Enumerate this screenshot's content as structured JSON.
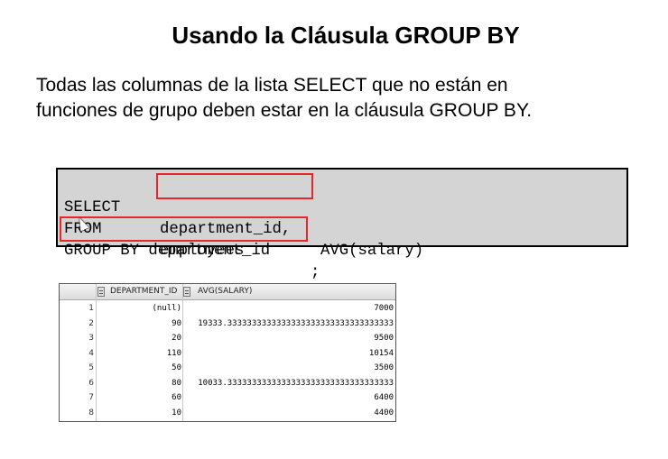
{
  "slide": {
    "title": "Usando la Cláusula GROUP BY",
    "body_line1": "Todas las columnas de la lista SELECT que no están en",
    "body_line2": "funciones de grupo deben estar en la cláusula GROUP BY."
  },
  "code": {
    "line1_kw": "SELECT",
    "line1_col": "department_id,",
    "line1_rest": "AVG(salary)",
    "line2_kw": "FROM",
    "line2_rest": "employees",
    "line3_groupby": "GROUP BY department_id",
    "line3_end": ";",
    "highlight_color": "#e8262c",
    "background": "#d4d4d4"
  },
  "result": {
    "columns": [
      "DEPARTMENT_ID",
      "AVG(SALARY)"
    ],
    "rows": [
      [
        "1",
        "(null)",
        "7000"
      ],
      [
        "2",
        "90",
        "19333.3333333333333333333333333333333333"
      ],
      [
        "3",
        "20",
        "9500"
      ],
      [
        "4",
        "110",
        "10154"
      ],
      [
        "5",
        "50",
        "3500"
      ],
      [
        "6",
        "80",
        "10033.3333333333333333333333333333333333"
      ],
      [
        "7",
        "60",
        "6400"
      ],
      [
        "8",
        "10",
        "4400"
      ]
    ]
  }
}
